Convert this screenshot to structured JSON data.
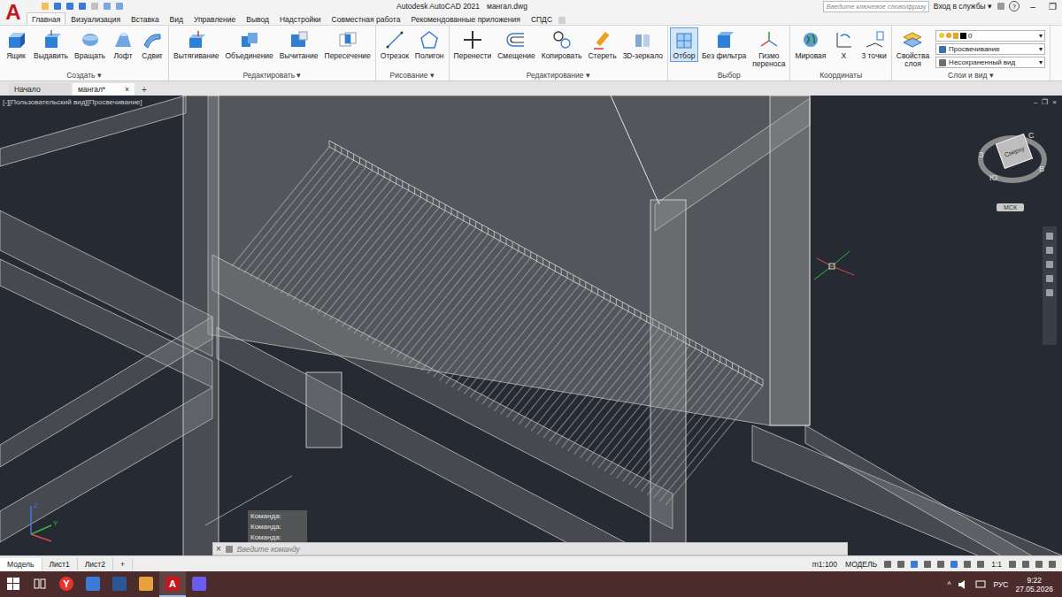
{
  "app": {
    "logo": "A",
    "title": "Autodesk AutoCAD 2021",
    "file": "мангал.dwg",
    "search_placeholder": "Введите ключевое слово/фразу",
    "signin": "Вход в службы ▾",
    "help": "?",
    "window_controls": [
      "–",
      "❐"
    ]
  },
  "ribbon_tabs": [
    {
      "label": "Главная",
      "selected": true
    },
    {
      "label": "Визуализация",
      "selected": false
    },
    {
      "label": "Вставка",
      "selected": false
    },
    {
      "label": "Вид",
      "selected": false
    },
    {
      "label": "Управление",
      "selected": false
    },
    {
      "label": "Вывод",
      "selected": false
    },
    {
      "label": "Надстройки",
      "selected": false
    },
    {
      "label": "Совместная работа",
      "selected": false
    },
    {
      "label": "Рекомендованные приложения",
      "selected": false
    },
    {
      "label": "СПДС",
      "selected": false
    }
  ],
  "ribbon_groups": [
    {
      "title": "Создать ▾",
      "buttons": [
        {
          "label": "Ящик",
          "selected": false
        },
        {
          "label": "Выдавить",
          "selected": false
        },
        {
          "label": "Вращать",
          "selected": false
        },
        {
          "label": "Лофт",
          "selected": false
        },
        {
          "label": "Сдвиг",
          "selected": false
        }
      ]
    },
    {
      "title": "Редактировать ▾",
      "buttons": [
        {
          "label": "Вытягивание",
          "selected": false
        },
        {
          "label": "Объединение",
          "selected": false
        },
        {
          "label": "Вычитание",
          "selected": false
        },
        {
          "label": "Пересечение",
          "selected": false
        }
      ]
    },
    {
      "title": "Рисование ▾",
      "buttons": [
        {
          "label": "Отрезок",
          "selected": false
        },
        {
          "label": "Полигон",
          "selected": false
        }
      ]
    },
    {
      "title": "Редактирование ▾",
      "buttons": [
        {
          "label": "Перенести",
          "selected": false
        },
        {
          "label": "Смещение",
          "selected": false
        },
        {
          "label": "Копировать",
          "selected": false
        },
        {
          "label": "Стереть",
          "selected": false
        },
        {
          "label": "3D-зеркало",
          "selected": false
        }
      ]
    },
    {
      "title": "Выбор",
      "buttons": [
        {
          "label": "Отбор",
          "selected": true
        },
        {
          "label": "Без фильтра",
          "selected": false
        },
        {
          "label": "Гизмо\nпереноса",
          "selected": false
        }
      ]
    },
    {
      "title": "Координаты",
      "buttons": [
        {
          "label": "Мировая",
          "selected": false
        },
        {
          "label": "X",
          "selected": false
        },
        {
          "label": "3 точки",
          "selected": false
        }
      ]
    },
    {
      "title": "Слои и вид ▾",
      "buttons": [
        {
          "label": "Свойства\nслоя",
          "selected": false
        }
      ]
    }
  ],
  "layer_panel": {
    "arrow": "▾",
    "layer": "0",
    "visual_style": "Просвечивание",
    "view": "Несохраненный вид"
  },
  "file_tabs": [
    {
      "label": "Начало",
      "selected": false
    },
    {
      "label": "мангал*",
      "selected": true
    }
  ],
  "file_tab_close": "×",
  "file_tab_add": "+",
  "viewport": {
    "label": "[-][Пользовательский вид][Просвечивание]",
    "controls": [
      "–",
      "❐",
      "×"
    ],
    "viewcube": {
      "top": "Сверху",
      "compass": [
        "С",
        "В",
        "Ю",
        "З"
      ],
      "ucs": "МСК"
    },
    "ucs_labels": [
      "Z",
      "Y"
    ]
  },
  "command": {
    "history": [
      "Команда:",
      "Команда:",
      "Команда:"
    ],
    "close": "×",
    "placeholder": "Введите команду"
  },
  "layout_tabs": [
    {
      "label": "Модель",
      "selected": true
    },
    {
      "label": "Лист1",
      "selected": false
    },
    {
      "label": "Лист2",
      "selected": false
    }
  ],
  "layout_add": "+",
  "status_items": [
    "m1:100",
    "МОДЕЛЬ",
    "1:1"
  ],
  "taskbar": {
    "apps": [
      {
        "kind": "taskview",
        "glyph": "",
        "selected": false
      },
      {
        "kind": "yandex",
        "glyph": "Y",
        "selected": false
      },
      {
        "kind": "file",
        "glyph": "",
        "selected": false
      },
      {
        "kind": "word",
        "glyph": "",
        "selected": false
      },
      {
        "kind": "photos",
        "glyph": "",
        "selected": false
      },
      {
        "kind": "autocad",
        "glyph": "A",
        "selected": true
      },
      {
        "kind": "messenger",
        "glyph": "",
        "selected": false
      }
    ],
    "chevron": "^",
    "lang": "РУС",
    "time": "9:22",
    "date": "27.05.2026"
  }
}
